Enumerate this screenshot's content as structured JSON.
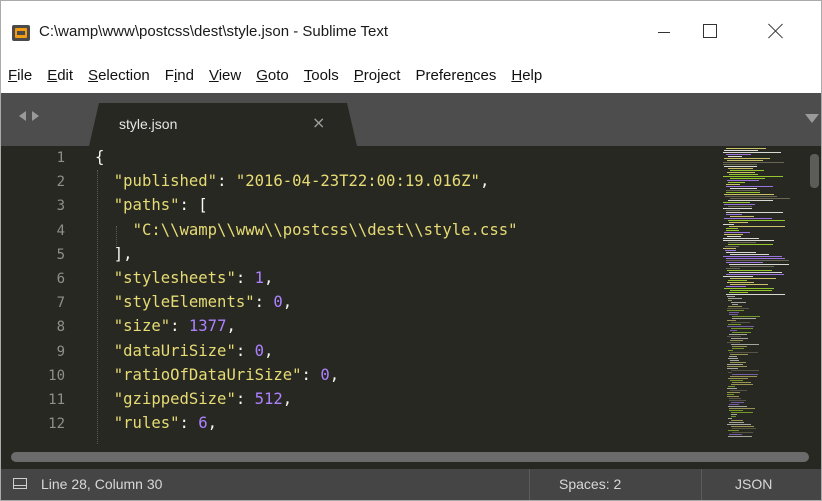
{
  "window": {
    "title": "C:\\wamp\\www\\postcss\\dest\\style.json - Sublime Text"
  },
  "menu": [
    {
      "pre": "",
      "u": "F",
      "post": "ile"
    },
    {
      "pre": "",
      "u": "E",
      "post": "dit"
    },
    {
      "pre": "",
      "u": "S",
      "post": "election"
    },
    {
      "pre": "F",
      "u": "i",
      "post": "nd"
    },
    {
      "pre": "",
      "u": "V",
      "post": "iew"
    },
    {
      "pre": "",
      "u": "G",
      "post": "oto"
    },
    {
      "pre": "",
      "u": "T",
      "post": "ools"
    },
    {
      "pre": "",
      "u": "P",
      "post": "roject"
    },
    {
      "pre": "Prefere",
      "u": "n",
      "post": "ces"
    },
    {
      "pre": "",
      "u": "H",
      "post": "elp"
    }
  ],
  "tab": {
    "label": "style.json",
    "close": "×"
  },
  "editor": {
    "line_numbers": [
      "1",
      "2",
      "3",
      "4",
      "5",
      "6",
      "7",
      "8",
      "9",
      "10",
      "11",
      "12"
    ],
    "lines": [
      [
        {
          "t": "p",
          "v": "{"
        }
      ],
      [
        {
          "t": "p",
          "v": "  "
        },
        {
          "t": "k",
          "v": "\"published\""
        },
        {
          "t": "p",
          "v": ": "
        },
        {
          "t": "s",
          "v": "\"2016-04-23T22:00:19.016Z\""
        },
        {
          "t": "p",
          "v": ","
        }
      ],
      [
        {
          "t": "p",
          "v": "  "
        },
        {
          "t": "k",
          "v": "\"paths\""
        },
        {
          "t": "p",
          "v": ": ["
        }
      ],
      [
        {
          "t": "p",
          "v": "    "
        },
        {
          "t": "s",
          "v": "\"C:\\\\wamp\\\\www\\\\postcss\\\\dest\\\\style.css\""
        }
      ],
      [
        {
          "t": "p",
          "v": "  ],"
        }
      ],
      [
        {
          "t": "p",
          "v": "  "
        },
        {
          "t": "k",
          "v": "\"stylesheets\""
        },
        {
          "t": "p",
          "v": ": "
        },
        {
          "t": "n",
          "v": "1"
        },
        {
          "t": "p",
          "v": ","
        }
      ],
      [
        {
          "t": "p",
          "v": "  "
        },
        {
          "t": "k",
          "v": "\"styleElements\""
        },
        {
          "t": "p",
          "v": ": "
        },
        {
          "t": "n",
          "v": "0"
        },
        {
          "t": "p",
          "v": ","
        }
      ],
      [
        {
          "t": "p",
          "v": "  "
        },
        {
          "t": "k",
          "v": "\"size\""
        },
        {
          "t": "p",
          "v": ": "
        },
        {
          "t": "n",
          "v": "1377"
        },
        {
          "t": "p",
          "v": ","
        }
      ],
      [
        {
          "t": "p",
          "v": "  "
        },
        {
          "t": "k",
          "v": "\"dataUriSize\""
        },
        {
          "t": "p",
          "v": ": "
        },
        {
          "t": "n",
          "v": "0"
        },
        {
          "t": "p",
          "v": ","
        }
      ],
      [
        {
          "t": "p",
          "v": "  "
        },
        {
          "t": "k",
          "v": "\"ratioOfDataUriSize\""
        },
        {
          "t": "p",
          "v": ": "
        },
        {
          "t": "n",
          "v": "0"
        },
        {
          "t": "p",
          "v": ","
        }
      ],
      [
        {
          "t": "p",
          "v": "  "
        },
        {
          "t": "k",
          "v": "\"gzippedSize\""
        },
        {
          "t": "p",
          "v": ": "
        },
        {
          "t": "n",
          "v": "512"
        },
        {
          "t": "p",
          "v": ","
        }
      ],
      [
        {
          "t": "p",
          "v": "  "
        },
        {
          "t": "k",
          "v": "\"rules\""
        },
        {
          "t": "p",
          "v": ": "
        },
        {
          "t": "n",
          "v": "6"
        },
        {
          "t": "p",
          "v": ","
        }
      ]
    ]
  },
  "status": {
    "position": "Line 28, Column 30",
    "spaces": "Spaces: 2",
    "syntax": "JSON"
  },
  "colors": {
    "editor_bg": "#272822",
    "key": "#e6db74",
    "number": "#ae81ff",
    "punct": "#f8f8f2",
    "line_number": "#8f908a",
    "tabbar_bg": "#4d4d4d",
    "status_bg": "#454545"
  }
}
